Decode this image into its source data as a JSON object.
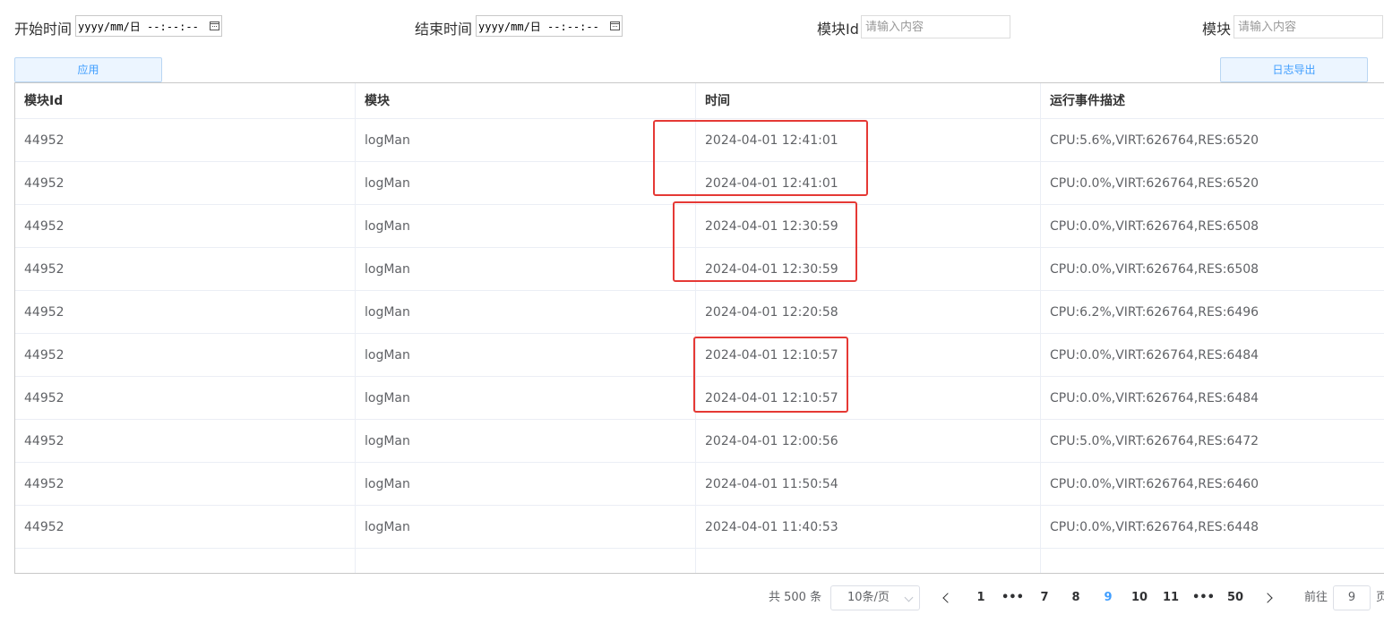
{
  "filters": {
    "start_label": "开始时间",
    "start_value": "yyyy/mm/日 --:--:--",
    "end_label": "结束时间",
    "end_value": "yyyy/mm/日 --:--:--",
    "module_id_label": "模块Id",
    "module_id_placeholder": "请输入内容",
    "module_label": "模块",
    "module_placeholder": "请输入内容"
  },
  "buttons": {
    "apply": "应用",
    "export": "日志导出"
  },
  "table": {
    "headers": [
      "模块Id",
      "模块",
      "时间",
      "运行事件描述"
    ],
    "rows": [
      [
        "44952",
        "logMan",
        "2024-04-01 12:41:01",
        "CPU:5.6%,VIRT:626764,RES:6520"
      ],
      [
        "44952",
        "logMan",
        "2024-04-01 12:41:01",
        "CPU:0.0%,VIRT:626764,RES:6520"
      ],
      [
        "44952",
        "logMan",
        "2024-04-01 12:30:59",
        "CPU:0.0%,VIRT:626764,RES:6508"
      ],
      [
        "44952",
        "logMan",
        "2024-04-01 12:30:59",
        "CPU:0.0%,VIRT:626764,RES:6508"
      ],
      [
        "44952",
        "logMan",
        "2024-04-01 12:20:58",
        "CPU:6.2%,VIRT:626764,RES:6496"
      ],
      [
        "44952",
        "logMan",
        "2024-04-01 12:10:57",
        "CPU:0.0%,VIRT:626764,RES:6484"
      ],
      [
        "44952",
        "logMan",
        "2024-04-01 12:10:57",
        "CPU:0.0%,VIRT:626764,RES:6484"
      ],
      [
        "44952",
        "logMan",
        "2024-04-01 12:00:56",
        "CPU:5.0%,VIRT:626764,RES:6472"
      ],
      [
        "44952",
        "logMan",
        "2024-04-01 11:50:54",
        "CPU:0.0%,VIRT:626764,RES:6460"
      ],
      [
        "44952",
        "logMan",
        "2024-04-01 11:40:53",
        "CPU:0.0%,VIRT:626764,RES:6448"
      ]
    ]
  },
  "pagination": {
    "total_text": "共 500 条",
    "page_size": "10条/页",
    "pages": [
      "1",
      "•••",
      "7",
      "8",
      "9",
      "10",
      "11",
      "•••",
      "50"
    ],
    "current": "9",
    "goto_label": "前往",
    "goto_value": "9",
    "page_suffix": "页"
  },
  "colors": {
    "highlight": "#e53935",
    "accent": "#409eff"
  }
}
